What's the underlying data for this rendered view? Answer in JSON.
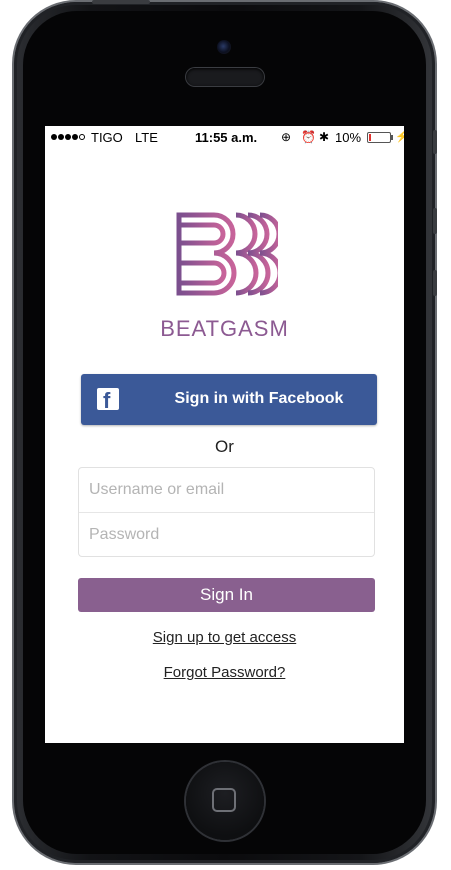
{
  "status_bar": {
    "carrier": "TIGO",
    "network": "LTE",
    "time": "11:55 a.m.",
    "battery_percent": "10%",
    "battery_level": 0.1,
    "icons": [
      "lock-rotation-icon",
      "alarm-icon",
      "bluetooth-icon",
      "battery-icon",
      "charging-icon"
    ]
  },
  "brand": {
    "name": "BEATGASM",
    "gradient_start": "#7b4f8e",
    "gradient_end": "#c8649a"
  },
  "facebook": {
    "label": "Sign in with Facebook",
    "color": "#3b5998",
    "icon": "facebook-icon"
  },
  "divider_text": "Or",
  "form": {
    "username_placeholder": "Username or email",
    "password_placeholder": "Password",
    "username_value": "",
    "password_value": ""
  },
  "signin": {
    "label": "Sign In",
    "color": "#89608f"
  },
  "links": {
    "signup": "Sign up to get access",
    "forgot": "Forgot Password?"
  }
}
